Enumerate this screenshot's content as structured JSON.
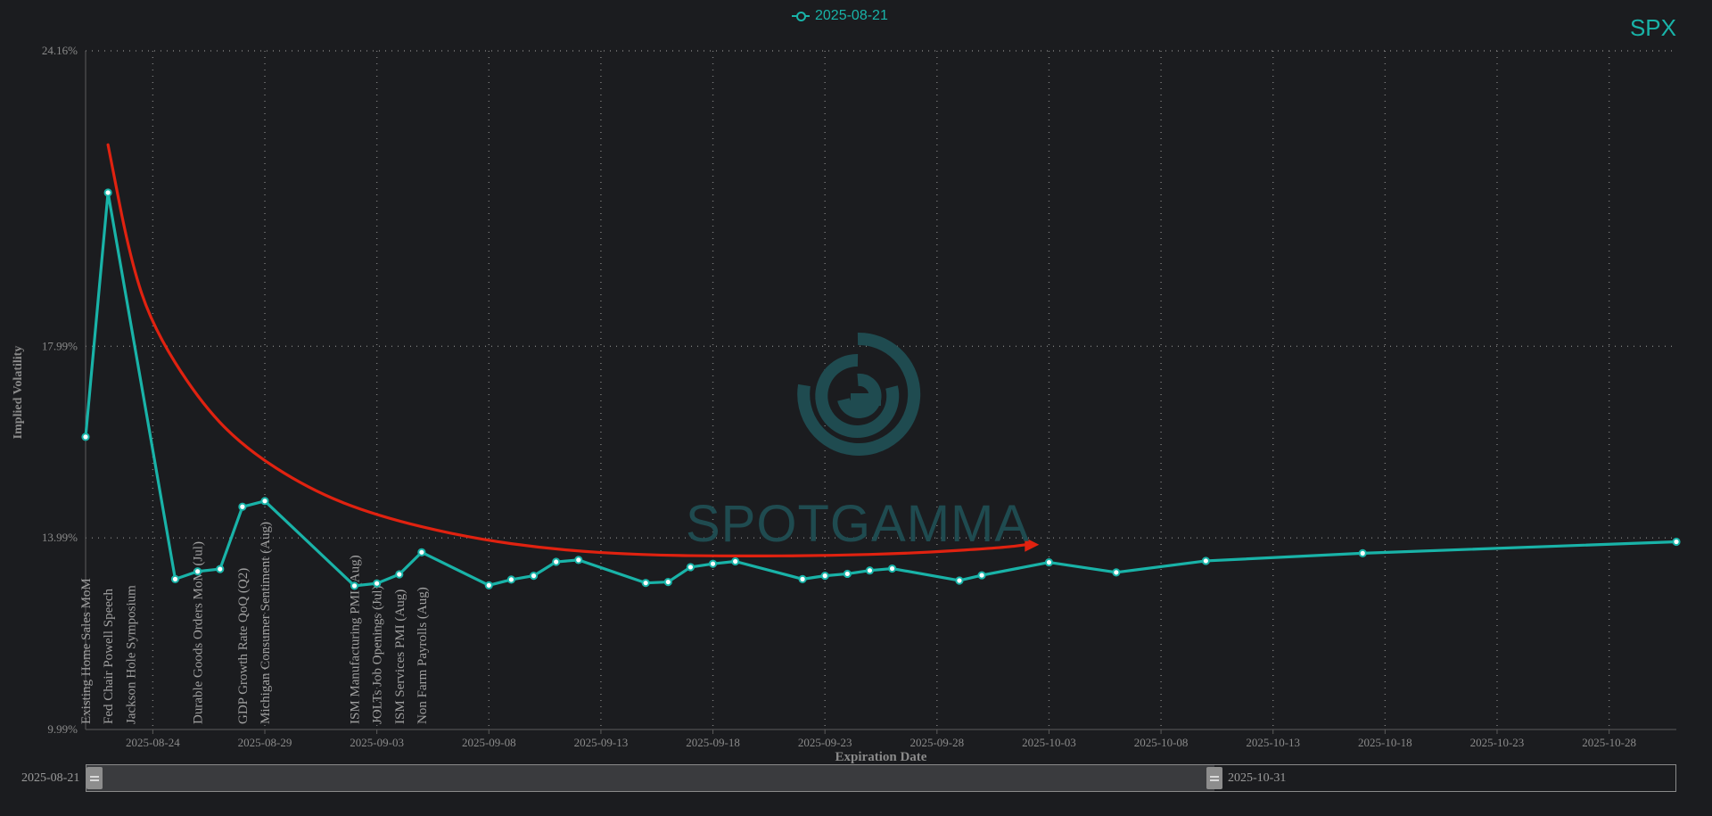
{
  "legend": {
    "label": "2025-08-21"
  },
  "symbol": "SPX",
  "watermark": "SPOTGAMMA",
  "range_slider": {
    "start_label": "2025-08-21",
    "end_label": "2025-10-31"
  },
  "colors": {
    "series": "#19b3a8",
    "arrow": "#e02210",
    "axis_text": "#8a8a8a",
    "grid": "#7a7a7a"
  },
  "chart_data": {
    "type": "line",
    "title": "",
    "xlabel": "Expiration Date",
    "ylabel": "Implied Volatility",
    "xlim": [
      "2025-08-21",
      "2025-10-31"
    ],
    "ylim": [
      9.99,
      24.16
    ],
    "y_ticks": [
      "24.16%",
      "17.99%",
      "13.99%",
      "9.99%"
    ],
    "y_tick_values": [
      24.16,
      17.99,
      13.99,
      9.99
    ],
    "x_ticks": [
      "2025-08-24",
      "2025-08-29",
      "2025-09-03",
      "2025-09-08",
      "2025-09-13",
      "2025-09-18",
      "2025-09-23",
      "2025-09-28",
      "2025-10-03",
      "2025-10-08",
      "2025-10-13",
      "2025-10-18",
      "2025-10-23",
      "2025-10-28"
    ],
    "grid": true,
    "series": [
      {
        "name": "2025-08-21",
        "x": [
          "2025-08-21",
          "2025-08-22",
          "2025-08-25",
          "2025-08-26",
          "2025-08-27",
          "2025-08-28",
          "2025-08-29",
          "2025-09-02",
          "2025-09-03",
          "2025-09-04",
          "2025-09-05",
          "2025-09-08",
          "2025-09-09",
          "2025-09-10",
          "2025-09-11",
          "2025-09-12",
          "2025-09-15",
          "2025-09-16",
          "2025-09-17",
          "2025-09-18",
          "2025-09-19",
          "2025-09-22",
          "2025-09-23",
          "2025-09-24",
          "2025-09-25",
          "2025-09-26",
          "2025-09-29",
          "2025-09-30",
          "2025-10-03",
          "2025-10-06",
          "2025-10-10",
          "2025-10-17",
          "2025-10-31"
        ],
        "y": [
          16.1,
          21.2,
          13.13,
          13.29,
          13.34,
          14.64,
          14.76,
          12.99,
          13.04,
          13.23,
          13.69,
          13.0,
          13.12,
          13.2,
          13.49,
          13.53,
          13.05,
          13.07,
          13.38,
          13.45,
          13.5,
          13.13,
          13.2,
          13.24,
          13.31,
          13.35,
          13.1,
          13.21,
          13.48,
          13.27,
          13.51,
          13.67,
          13.91
        ]
      }
    ],
    "annotations": [
      {
        "text": "Existing Home Sales MoM",
        "date": "2025-08-21"
      },
      {
        "text": "Fed Chair Powell Speech",
        "date": "2025-08-22"
      },
      {
        "text": "Jackson Hole Symposium",
        "date": "2025-08-23"
      },
      {
        "text": "Durable Goods Orders MoM (Jul)",
        "date": "2025-08-26"
      },
      {
        "text": "GDP Growth Rate QoQ (Q2)",
        "date": "2025-08-28"
      },
      {
        "text": "Michigan Consumer Sentiment (Aug)",
        "date": "2025-08-29"
      },
      {
        "text": "ISM Manufacturing PMI (Aug)",
        "date": "2025-09-02"
      },
      {
        "text": "JOLTs Job Openings (Jul)",
        "date": "2025-09-03"
      },
      {
        "text": "ISM Services PMI (Aug)",
        "date": "2025-09-04"
      },
      {
        "text": "Non Farm Payrolls (Aug)",
        "date": "2025-09-05"
      }
    ],
    "trend_arrow": {
      "x": [
        "2025-08-22",
        "2025-08-23",
        "2025-08-24",
        "2025-08-26",
        "2025-08-28",
        "2025-08-31",
        "2025-09-03",
        "2025-09-07",
        "2025-09-11",
        "2025-09-15",
        "2025-09-19",
        "2025-09-23",
        "2025-09-27",
        "2025-10-01",
        "2025-10-02"
      ],
      "y": [
        22.2,
        19.8,
        18.4,
        16.9,
        15.9,
        15.0,
        14.45,
        14.0,
        13.74,
        13.63,
        13.61,
        13.62,
        13.67,
        13.79,
        13.85
      ]
    }
  }
}
